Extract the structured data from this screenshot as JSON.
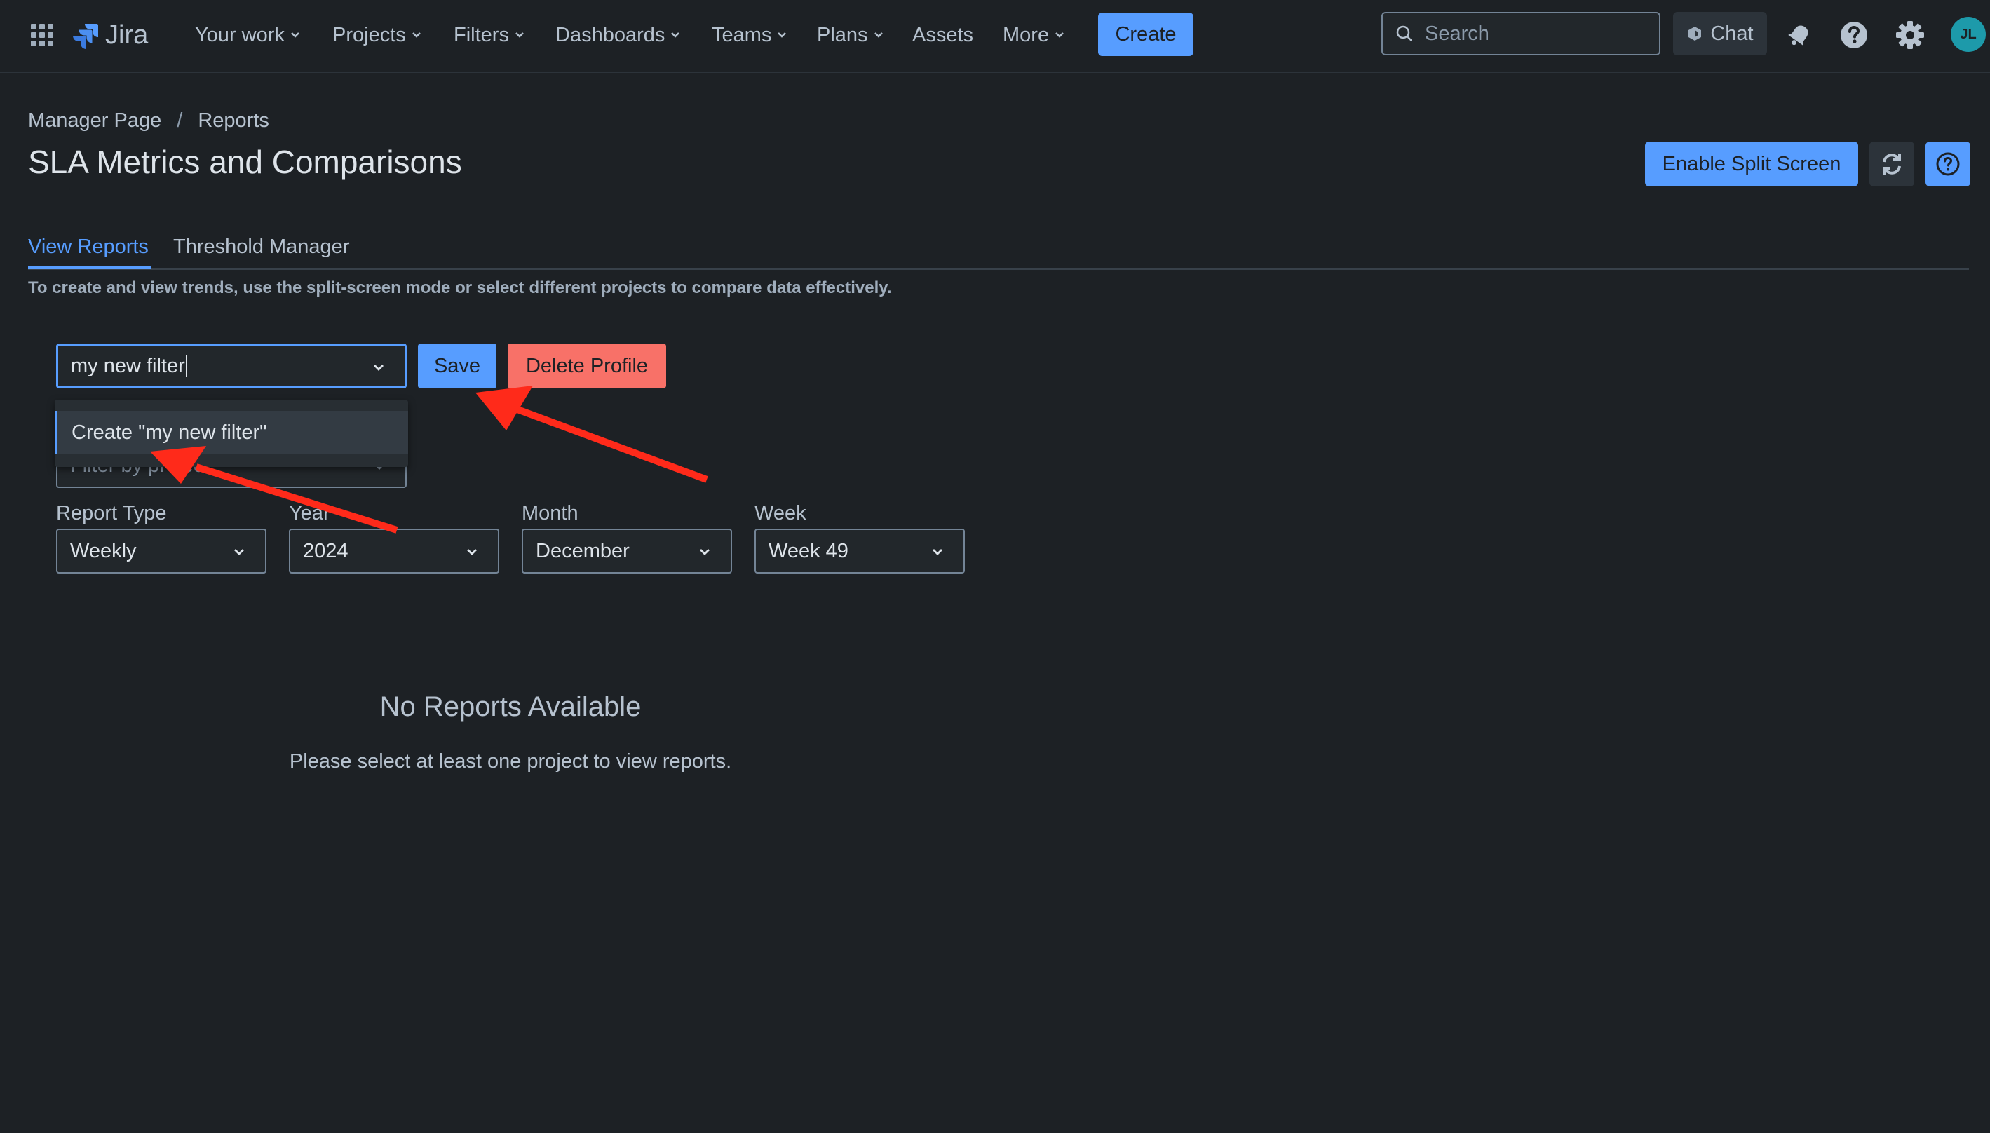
{
  "nav": {
    "logo_text": "Jira",
    "items": [
      {
        "label": "Your work",
        "dropdown": true
      },
      {
        "label": "Projects",
        "dropdown": true
      },
      {
        "label": "Filters",
        "dropdown": true
      },
      {
        "label": "Dashboards",
        "dropdown": true
      },
      {
        "label": "Teams",
        "dropdown": true
      },
      {
        "label": "Plans",
        "dropdown": true
      },
      {
        "label": "Assets",
        "dropdown": false
      },
      {
        "label": "More",
        "dropdown": true
      }
    ],
    "create_label": "Create",
    "search_placeholder": "Search",
    "chat_label": "Chat",
    "avatar_initials": "JL"
  },
  "breadcrumb": {
    "parent": "Manager Page",
    "separator": "/",
    "current": "Reports"
  },
  "page_title": "SLA Metrics and Comparisons",
  "header_actions": {
    "split_screen_label": "Enable Split Screen"
  },
  "tabs": [
    {
      "label": "View Reports",
      "active": true
    },
    {
      "label": "Threshold Manager",
      "active": false
    }
  ],
  "hint": "To create and view trends, use the split-screen mode or select different projects to compare data effectively.",
  "profile": {
    "input_value": "my new filter",
    "save_label": "Save",
    "delete_label": "Delete Profile",
    "menu_option": "Create \"my new filter\""
  },
  "project_filter": {
    "placeholder": "Filter by project"
  },
  "filters": {
    "report_type": {
      "label": "Report Type",
      "value": "Weekly"
    },
    "year": {
      "label": "Year",
      "value": "2024"
    },
    "month": {
      "label": "Month",
      "value": "December"
    },
    "week": {
      "label": "Week",
      "value": "Week 49"
    }
  },
  "empty_state": {
    "title": "No Reports Available",
    "message": "Please select at least one project to view reports."
  },
  "colors": {
    "accent": "#579dff",
    "danger": "#f87168",
    "background": "#1d2125",
    "annotation": "#ff2a1a"
  }
}
